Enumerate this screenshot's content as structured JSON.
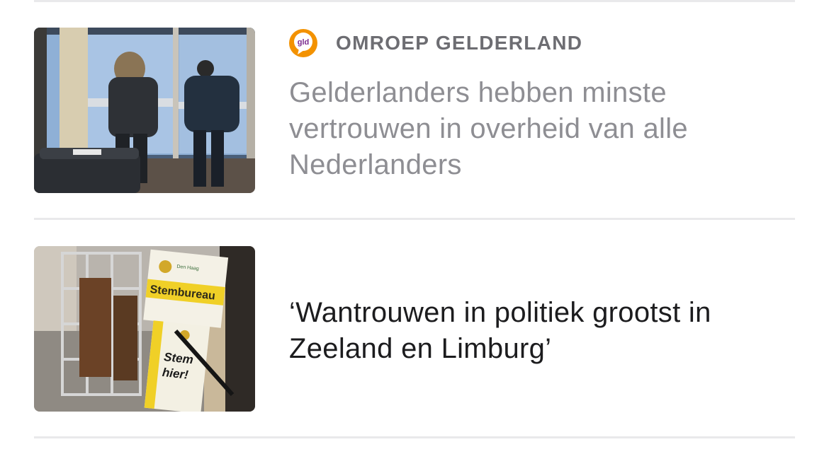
{
  "feed": {
    "articles": [
      {
        "source": {
          "logo_text": "gld",
          "logo_colors": {
            "ring": "#f39200",
            "text": "#7a2a8f"
          },
          "name": "OMROEP GELDERLAND"
        },
        "headline": "Gelderlanders hebben minste vertrouwen in overheid van alle Nederlanders",
        "headline_state": "read",
        "thumbnail_icon": "voting-booths-photo"
      },
      {
        "headline": "‘Wantrouwen in politiek grootst in Zeeland en Limburg’",
        "headline_state": "unread",
        "thumbnail_icon": "stembureau-sign-photo",
        "thumbnail_text": {
          "sign_small": "Den Haag",
          "sign_label": "Stembureau",
          "poster_line1": "Stem",
          "poster_line2": "hier!"
        }
      }
    ]
  },
  "colors": {
    "divider": "#e9e9eb",
    "source_name": "#6d6d72",
    "headline_read": "#8e8e93",
    "headline_unread": "#1c1c1e"
  }
}
